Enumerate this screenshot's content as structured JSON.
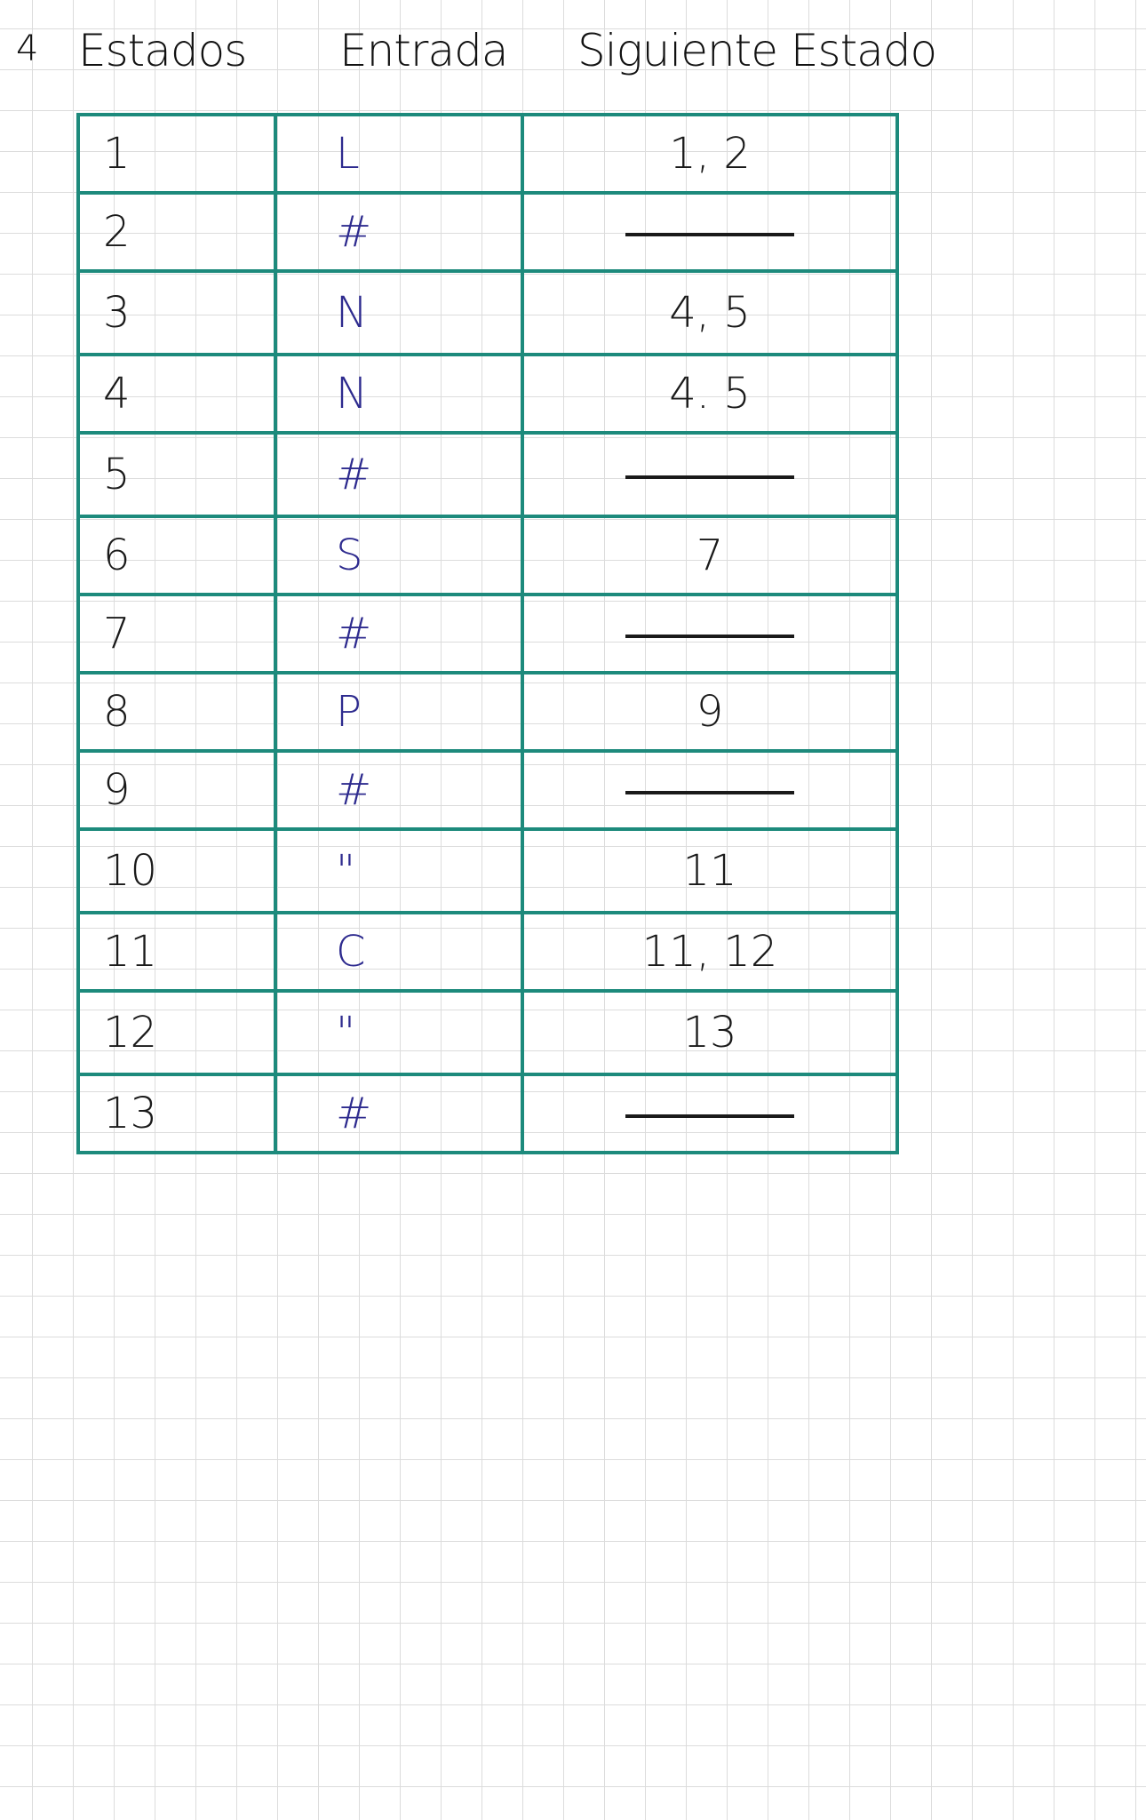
{
  "header": {
    "number": "4",
    "columns": [
      "Estados",
      "Entrada",
      "Siguiente Estado"
    ]
  },
  "rows": [
    {
      "estado": "1",
      "entrada": "L",
      "siguiente": "1, 2"
    },
    {
      "estado": "2",
      "entrada": "#",
      "siguiente": ""
    },
    {
      "estado": "3",
      "entrada": "N",
      "siguiente": "4, 5"
    },
    {
      "estado": "4",
      "entrada": "N",
      "siguiente": "4. 5"
    },
    {
      "estado": "5",
      "entrada": "#",
      "siguiente": ""
    },
    {
      "estado": "6",
      "entrada": "S",
      "siguiente": "7"
    },
    {
      "estado": "7",
      "entrada": "#",
      "siguiente": ""
    },
    {
      "estado": "8",
      "entrada": "P",
      "siguiente": "9"
    },
    {
      "estado": "9",
      "entrada": "#",
      "siguiente": ""
    },
    {
      "estado": "10",
      "entrada": "\"",
      "siguiente": "11"
    },
    {
      "estado": "11",
      "entrada": "C",
      "siguiente": "11, 12"
    },
    {
      "estado": "12",
      "entrada": "\"",
      "siguiente": "13"
    },
    {
      "estado": "13",
      "entrada": "#",
      "siguiente": ""
    }
  ],
  "colors": {
    "table_border": "#1d8a7c",
    "entrada_ink": "#2d2a8e",
    "ink": "#1a1a1a",
    "grid": "#dcdcdc"
  }
}
